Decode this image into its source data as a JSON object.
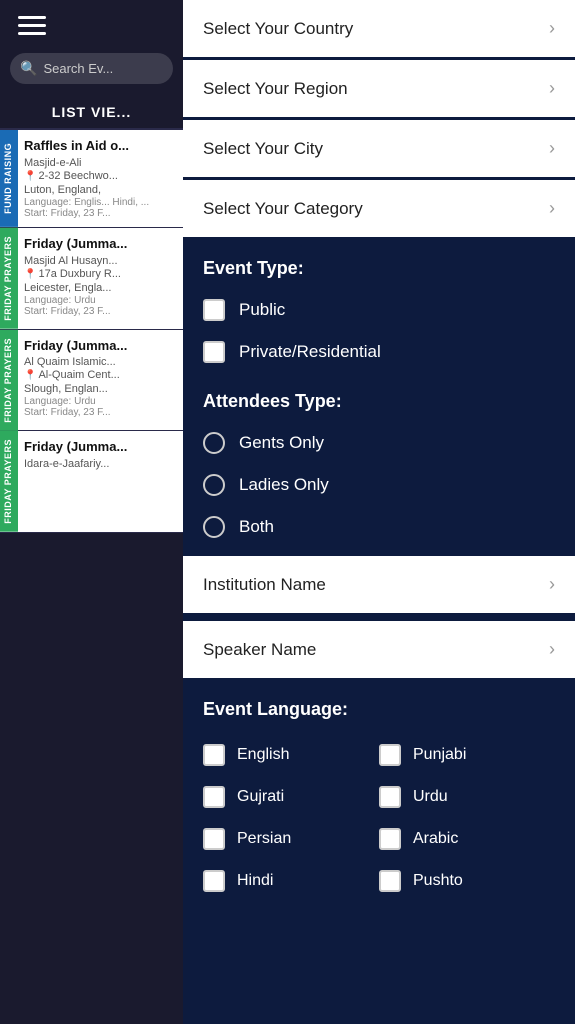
{
  "sidebar": {
    "search_placeholder": "Search Ev...",
    "list_view_label": "LIST VIE...",
    "events": [
      {
        "tag": "FUND RAISING",
        "tag_class": "fundraising",
        "title": "Raffles in Aid o...",
        "org": "Masjid-e-Ali",
        "address": "2-32 Beechwo...",
        "city": "Luton, England,",
        "language_label": "Language:",
        "language": "Englis... Hindi, ...",
        "start": "Start: Friday, 23 F..."
      },
      {
        "tag": "FRIDAY PRAYERS",
        "tag_class": "friday",
        "title": "Friday (Jumma...",
        "org": "Masjid Al Husayn...",
        "address": "17a Duxbury R...",
        "city": "Leicester, Engla...",
        "language_label": "Language:",
        "language": "Urdu",
        "start": "Start: Friday, 23 F..."
      },
      {
        "tag": "FRIDAY PRAYERS",
        "tag_class": "friday",
        "title": "Friday (Jumma...",
        "org": "Al Quaim Islamic...",
        "address": "Al-Quaim Cent...",
        "city": "Slough, Englan...",
        "language_label": "Language:",
        "language": "Urdu",
        "start": "Start: Friday, 23 F..."
      },
      {
        "tag": "FRIDAY PRAYERS",
        "tag_class": "friday",
        "title": "Friday (Jumma...",
        "org": "Idara-e-Jaafariy...",
        "address": "",
        "city": "",
        "language_label": "",
        "language": "",
        "start": ""
      }
    ]
  },
  "filter": {
    "select_country_label": "Select Your Country",
    "select_region_label": "Select Your Region",
    "select_city_label": "Select Your City",
    "select_category_label": "Select Your Category",
    "event_type_header": "Event Type:",
    "public_label": "Public",
    "private_label": "Private/Residential",
    "attendees_type_header": "Attendees Type:",
    "gents_only_label": "Gents Only",
    "ladies_only_label": "Ladies Only",
    "both_label": "Both",
    "institution_name_label": "Institution Name",
    "speaker_name_label": "Speaker Name",
    "event_language_header": "Event Language:",
    "languages": [
      {
        "name": "English",
        "col": 0
      },
      {
        "name": "Punjabi",
        "col": 1
      },
      {
        "name": "Gujrati",
        "col": 0
      },
      {
        "name": "Urdu",
        "col": 1
      },
      {
        "name": "Persian",
        "col": 0
      },
      {
        "name": "Arabic",
        "col": 1
      },
      {
        "name": "Hindi",
        "col": 0
      },
      {
        "name": "Pushto",
        "col": 1
      }
    ]
  }
}
